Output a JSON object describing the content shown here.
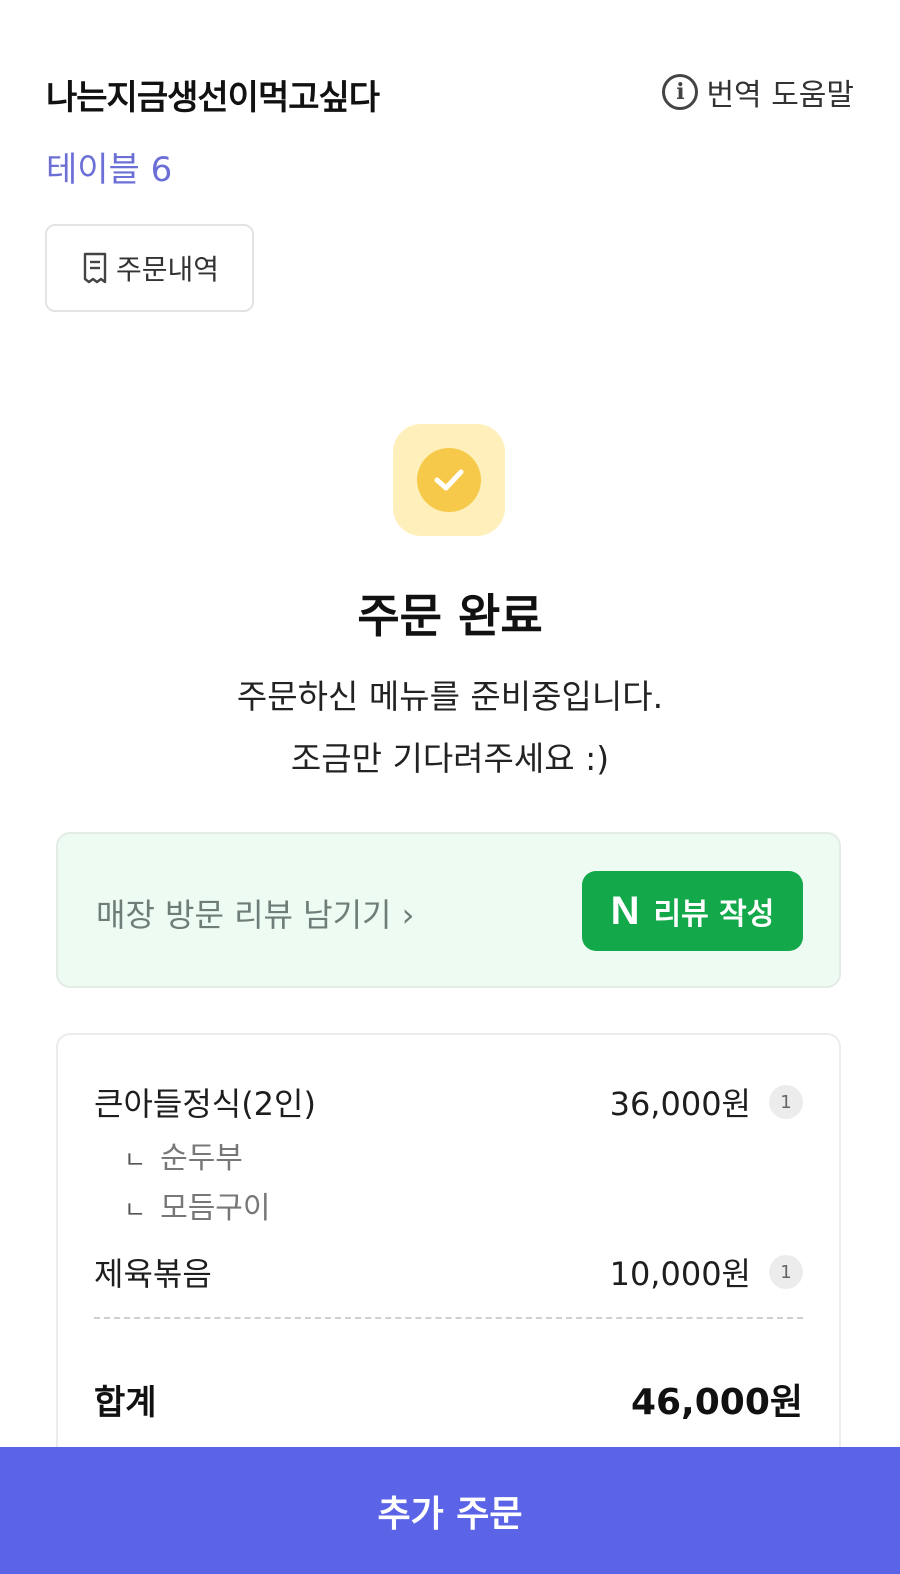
{
  "header": {
    "store_name": "나는지금생선이먹고싶다",
    "help_label": "번역 도움말",
    "help_icon": "info-icon",
    "table_label": "테이블 6",
    "history_button": "주문내역",
    "history_icon": "receipt-icon"
  },
  "status": {
    "icon": "check-circle-icon",
    "title": "주문 완료",
    "message_line1": "주문하신 메뉴를 준비중입니다.",
    "message_line2": "조금만 기다려주세요 :)"
  },
  "review": {
    "link_text": "매장 방문 리뷰 남기기 ›",
    "button_logo": "N",
    "button_label": "리뷰 작성"
  },
  "order": {
    "items": [
      {
        "name": "큰아들정식(2인)",
        "price": "36,000원",
        "qty": "1",
        "options": [
          "순두부",
          "모듬구이"
        ]
      },
      {
        "name": "제육볶음",
        "price": "10,000원",
        "qty": "1",
        "options": []
      }
    ],
    "option_marker": "ㄴ",
    "total_label": "합계",
    "total_value": "46,000원"
  },
  "footer": {
    "add_order_label": "추가 주문"
  },
  "colors": {
    "accent": "#5b64e6",
    "table_label": "#6b6fd6",
    "naver_green": "#13a94b",
    "success_yellow": "#f7c94a"
  }
}
